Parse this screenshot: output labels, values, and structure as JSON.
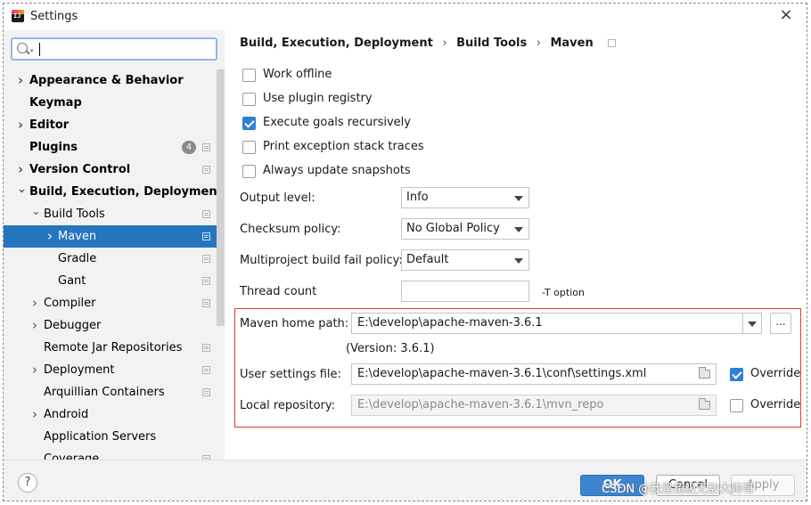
{
  "window": {
    "title": "Settings",
    "close_glyph": "×"
  },
  "search": {
    "value": "",
    "placeholder": ""
  },
  "sidebar": {
    "items": [
      {
        "label": "Appearance & Behavior"
      },
      {
        "label": "Keymap"
      },
      {
        "label": "Editor"
      },
      {
        "label": "Plugins",
        "badge": "4"
      },
      {
        "label": "Version Control"
      },
      {
        "label": "Build, Execution, Deployment"
      },
      {
        "label": "Build Tools"
      },
      {
        "label": "Maven"
      },
      {
        "label": "Gradle"
      },
      {
        "label": "Gant"
      },
      {
        "label": "Compiler"
      },
      {
        "label": "Debugger"
      },
      {
        "label": "Remote Jar Repositories"
      },
      {
        "label": "Deployment"
      },
      {
        "label": "Arquillian Containers"
      },
      {
        "label": "Android"
      },
      {
        "label": "Application Servers"
      },
      {
        "label": "Coverage"
      }
    ],
    "selected": "Maven"
  },
  "breadcrumb": {
    "items": [
      "Build, Execution, Deployment",
      "Build Tools",
      "Maven"
    ],
    "separator": "›"
  },
  "options": {
    "work_offline": {
      "label": "Work offline",
      "checked": false
    },
    "plugin_registry": {
      "label": "Use plugin registry",
      "checked": false
    },
    "recursive": {
      "label": "Execute goals recursively",
      "checked": true
    },
    "stack_traces": {
      "label": "Print exception stack traces",
      "checked": false
    },
    "snapshots": {
      "label": "Always update snapshots",
      "checked": false
    }
  },
  "form": {
    "output_level": {
      "label": "Output level:",
      "value": "Info"
    },
    "checksum_policy": {
      "label": "Checksum policy:",
      "value": "No Global Policy"
    },
    "fail_policy": {
      "label": "Multiproject build fail policy:",
      "value": "Default"
    },
    "thread_count": {
      "label": "Thread count",
      "value": "",
      "hint": "-T option"
    },
    "maven_home": {
      "label": "Maven home path:",
      "value": "E:\\develop\\apache-maven-3.6.1",
      "version": "(Version: 3.6.1)",
      "browse": "..."
    },
    "user_settings": {
      "label": "User settings file:",
      "value": "E:\\develop\\apache-maven-3.6.1\\conf\\settings.xml",
      "override_label": "Override",
      "override": true
    },
    "local_repo": {
      "label": "Local repository:",
      "value": "E:\\develop\\apache-maven-3.6.1\\mvn_repo",
      "override_label": "Override",
      "override": false
    }
  },
  "footer": {
    "help": "?",
    "ok": "OK",
    "cancel": "Cancel",
    "apply": "Apply"
  },
  "watermark": "CSDN @我是超级无敌大帅哥",
  "colors": {
    "selection": "#2675bf",
    "accent": "#2f7fd5",
    "highlight_box": "#e23b3b"
  }
}
